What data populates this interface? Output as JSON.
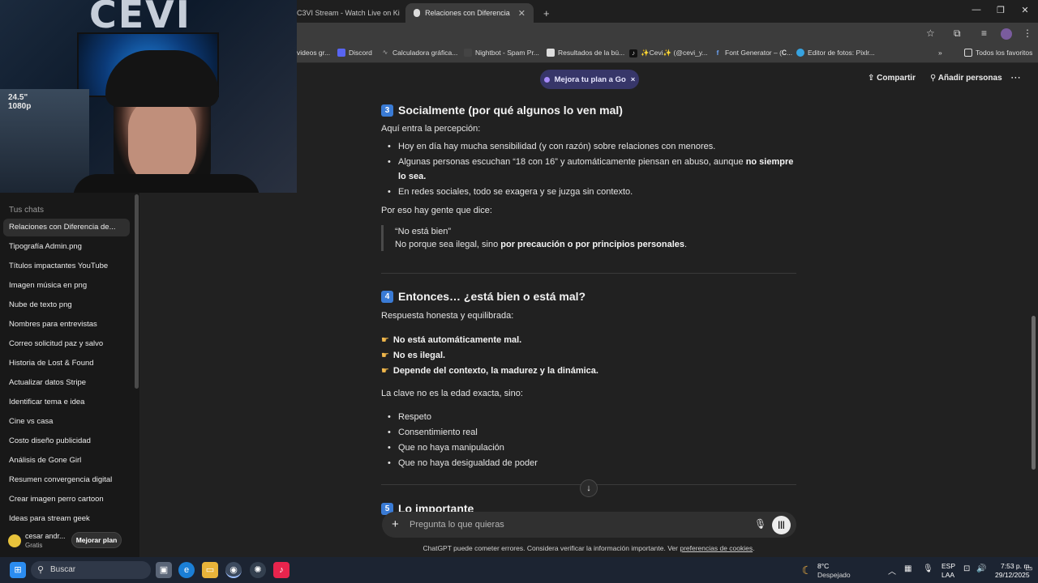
{
  "browser": {
    "tabs": [
      {
        "label": "C3VI Stream - Watch Live on Ki"
      },
      {
        "label": "Relaciones con Diferencia de Ed"
      }
    ],
    "new_tab": "+",
    "bookmarks": [
      {
        "label": "videos gr..."
      },
      {
        "label": "Discord"
      },
      {
        "label": "Calculadora gráfica..."
      },
      {
        "label": "Nightbot - Spam Pr..."
      },
      {
        "label": "Resultados de la bú..."
      },
      {
        "label": "✨Cevi✨ (@cevi_y..."
      },
      {
        "label": "Font Generator – (𝐂..."
      },
      {
        "label": "Editor de fotos: Pixlr..."
      }
    ],
    "all_bookmarks": "Todos los favoritos"
  },
  "webcam": {
    "logo_text": "CEVI",
    "badge_line1": "24.5\"",
    "badge_line2": "1080p"
  },
  "sidebar": {
    "section_title": "Tus chats",
    "chats": [
      "Relaciones con Diferencia de...",
      "Tipografía Admin.png",
      "Títulos impactantes YouTube",
      "Imagen música en png",
      "Nube de texto png",
      "Nombres para entrevistas",
      "Correo solicitud paz y salvo",
      "Historia de Lost & Found",
      "Actualizar datos Stripe",
      "Identificar tema e idea",
      "Cine vs casa",
      "Costo diseño publicidad",
      "Análisis de Gone Girl",
      "Resumen convergencia digital",
      "Crear imagen perro cartoon",
      "Ideas para stream geek"
    ],
    "user": {
      "name": "cesar andr...",
      "plan": "Gratis",
      "upgrade_label": "Mejorar plan"
    }
  },
  "header": {
    "plan_pill": "Mejora tu plan a Go",
    "plan_close": "×",
    "share": "Compartir",
    "add_people": "Añadir personas",
    "more": "⋯"
  },
  "content": {
    "section3": {
      "num": "3",
      "title": "Socialmente (por qué algunos lo ven mal)",
      "intro": "Aquí entra la percepción:",
      "bullets": [
        "Hoy en día hay mucha sensibilidad (y con razón) sobre relaciones con menores.",
        "Algunas personas escuchan “18 con 16” y automáticamente piensan en abuso, aunque",
        "no siempre lo sea",
        "En redes sociales, todo se exagera y se juzga sin contexto."
      ],
      "outro": "Por eso hay gente que dice:",
      "quote_line1": "“No está bien”",
      "quote_line2_prefix": "No porque sea ilegal, sino ",
      "quote_line2_bold": "por precaución o por principios personales",
      "quote_line2_suffix": "."
    },
    "section4": {
      "num": "4",
      "title": "Entonces… ¿está bien o está mal?",
      "intro": "Respuesta honesta y equilibrada:",
      "points": [
        "No está automáticamente mal.",
        "No es ilegal.",
        "Depende del contexto, la madurez y la dinámica."
      ],
      "key_text": "La clave no es la edad exacta, sino:",
      "bullets": [
        "Respeto",
        "Consentimiento real",
        "Que no haya manipulación",
        "Que no haya desigualdad de poder"
      ]
    },
    "section5": {
      "num": "5",
      "title": "Lo importante"
    }
  },
  "composer": {
    "placeholder": "Pregunta lo que quieras",
    "disclaimer_prefix": "ChatGPT puede cometer errores. Considera verificar la información importante. Ver ",
    "disclaimer_link": "preferencias de cookies",
    "disclaimer_suffix": "."
  },
  "taskbar": {
    "search": "Buscar",
    "weather_temp": "8°C",
    "weather_desc": "Despejado",
    "lang1": "ESP",
    "lang2": "LAA",
    "time": "7:53 p. m.",
    "date": "29/12/2025"
  }
}
